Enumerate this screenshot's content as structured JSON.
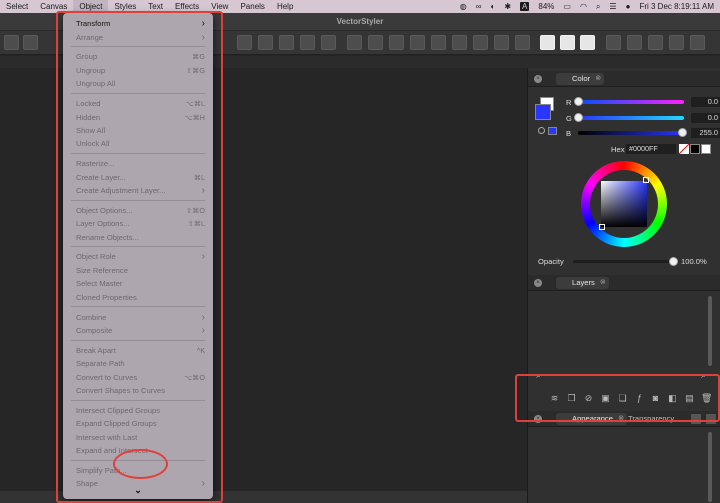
{
  "menubar": {
    "items": [
      "Select",
      "Canvas",
      "Object",
      "Styles",
      "Text",
      "Effects",
      "View",
      "Panels",
      "Help"
    ],
    "active": "Object",
    "status": {
      "battery": "84%",
      "datetime": "Fri 3 Dec  8:19:11 AM",
      "keyboard": "A"
    }
  },
  "window": {
    "title": "VectorStyler"
  },
  "object_menu": {
    "groups": [
      [
        {
          "label": "Transform",
          "submenu": true,
          "enabled": true
        },
        {
          "label": "Arrange",
          "submenu": true,
          "enabled": false
        }
      ],
      [
        {
          "label": "Group",
          "shortcut": "⌘G",
          "enabled": false
        },
        {
          "label": "Ungroup",
          "shortcut": "⇧⌘G",
          "enabled": false
        },
        {
          "label": "Ungroup All",
          "enabled": false
        }
      ],
      [
        {
          "label": "Locked",
          "shortcut": "⌥⌘L",
          "enabled": false
        },
        {
          "label": "Hidden",
          "shortcut": "⌥⌘H",
          "enabled": false
        },
        {
          "label": "Show All",
          "enabled": false
        },
        {
          "label": "Unlock All",
          "enabled": false
        }
      ],
      [
        {
          "label": "Rasterize...",
          "enabled": false
        },
        {
          "label": "Create Layer...",
          "shortcut": "⌘L",
          "enabled": false
        },
        {
          "label": "Create Adjustment Layer...",
          "submenu": true,
          "enabled": false
        }
      ],
      [
        {
          "label": "Object Options...",
          "shortcut": "⇧⌘O",
          "enabled": false
        },
        {
          "label": "Layer Options...",
          "shortcut": "⇧⌘L",
          "enabled": false
        },
        {
          "label": "Rename Objects...",
          "enabled": false
        }
      ],
      [
        {
          "label": "Object Role",
          "submenu": true,
          "enabled": false
        },
        {
          "label": "Size Reference",
          "enabled": false
        },
        {
          "label": "Select Master",
          "enabled": false
        },
        {
          "label": "Cloned Properties",
          "enabled": false
        }
      ],
      [
        {
          "label": "Combine",
          "submenu": true,
          "enabled": false
        },
        {
          "label": "Composite",
          "submenu": true,
          "enabled": false
        }
      ],
      [
        {
          "label": "Break Apart",
          "shortcut": "^K",
          "enabled": false
        },
        {
          "label": "Separate Path",
          "enabled": false
        },
        {
          "label": "Convert to Curves",
          "shortcut": "⌥⌘O",
          "enabled": false
        },
        {
          "label": "Convert Shapes to Curves",
          "enabled": false
        }
      ],
      [
        {
          "label": "Intersect Clipped Groups",
          "enabled": false
        },
        {
          "label": "Expand Clipped Groups",
          "enabled": false
        },
        {
          "label": "Intersect with Last",
          "enabled": false
        },
        {
          "label": "Expand and Intersect",
          "enabled": false
        }
      ],
      [
        {
          "label": "Simplify Path...",
          "enabled": false
        },
        {
          "label": "Shape",
          "submenu": true,
          "enabled": false
        }
      ]
    ],
    "more_indicator": "⌄"
  },
  "color_panel": {
    "tab": "Color",
    "channels": [
      {
        "name": "R",
        "value": "0.0",
        "fraction": 0.0
      },
      {
        "name": "G",
        "value": "0.0",
        "fraction": 0.0
      },
      {
        "name": "B",
        "value": "255.0",
        "fraction": 1.0
      }
    ],
    "hex_label": "Hex",
    "hex_value": "#0000FF",
    "opacity_label": "Opacity",
    "opacity_value": "100.0%",
    "opacity_fraction": 1.0,
    "fill_color": "#2a36ff"
  },
  "layers_panel": {
    "tab": "Layers"
  },
  "bottom_panel": {
    "tabs": [
      "Appearance",
      "Transparency"
    ]
  },
  "colors": {
    "annotation": "#e0403a",
    "accent_blue": "#2a36ff"
  }
}
